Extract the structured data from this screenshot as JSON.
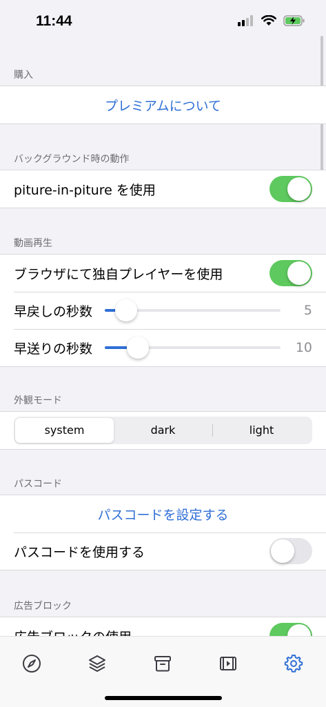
{
  "status": {
    "time": "11:44"
  },
  "sections": {
    "purchase": {
      "header": "購入",
      "premium_link": "プレミアムについて"
    },
    "background": {
      "header": "バックグラウンド時の動作",
      "pip_label": "piture-in-piture を使用",
      "pip_on": true
    },
    "playback": {
      "header": "動画再生",
      "custom_player_label": "ブラウザにて独自プレイヤーを使用",
      "custom_player_on": true,
      "rewind_label": "早戻しの秒数",
      "rewind_value": "5",
      "forward_label": "早送りの秒数",
      "forward_value": "10"
    },
    "appearance": {
      "header": "外観モード",
      "options": [
        "system",
        "dark",
        "light"
      ],
      "selected": "system"
    },
    "passcode": {
      "header": "パスコード",
      "set_link": "パスコードを設定する",
      "use_label": "パスコードを使用する",
      "use_on": false
    },
    "adblock": {
      "header": "広告ブロック",
      "use_label": "広告ブロックの使用",
      "use_on": true
    }
  },
  "tabbar": {
    "items": [
      "compass-icon",
      "layers-icon",
      "archive-icon",
      "video-icon",
      "gear-icon"
    ],
    "active": "gear-icon",
    "active_color": "#2f6fd6",
    "inactive_color": "#3c3c43"
  }
}
